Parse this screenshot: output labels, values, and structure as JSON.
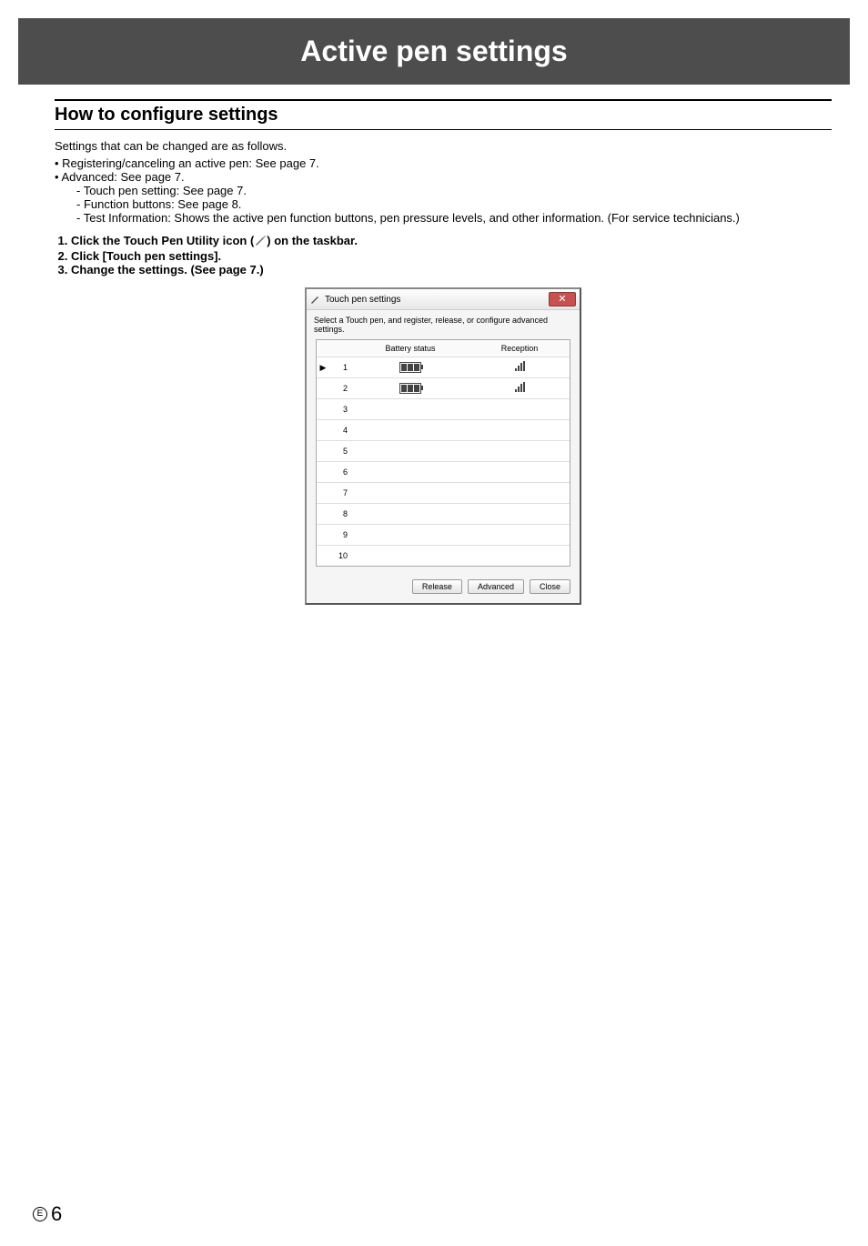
{
  "header": {
    "title": "Active pen settings"
  },
  "section": {
    "title": "How to configure settings"
  },
  "intro": "Settings that can be changed are as follows.",
  "bullets": {
    "b1": "Registering/canceling an active pen: See page 7.",
    "b2": "Advanced: See page 7.",
    "sub1": "Touch pen setting: See page 7.",
    "sub2": "Function buttons: See page 8.",
    "sub3": "Test Information: Shows the active pen function buttons, pen pressure levels, and other information. (For service technicians.)"
  },
  "steps": {
    "s1a": "Click the Touch Pen Utility icon (",
    "s1b": ") on the taskbar.",
    "s2": "Click [Touch pen settings].",
    "s3": "Change the settings. (See page 7.)"
  },
  "dialog": {
    "title": "Touch pen settings",
    "instruction": "Select a Touch pen, and register, release, or configure advanced settings.",
    "col_battery": "Battery status",
    "col_reception": "Reception",
    "rows": [
      {
        "n": "1",
        "selected": true,
        "battery": true,
        "signal": true
      },
      {
        "n": "2",
        "selected": false,
        "battery": true,
        "signal": true
      },
      {
        "n": "3"
      },
      {
        "n": "4"
      },
      {
        "n": "5"
      },
      {
        "n": "6"
      },
      {
        "n": "7"
      },
      {
        "n": "8"
      },
      {
        "n": "9"
      },
      {
        "n": "10"
      }
    ],
    "btn_release": "Release",
    "btn_advanced": "Advanced",
    "btn_close": "Close"
  },
  "footer": {
    "lang": "E",
    "page": "6"
  }
}
